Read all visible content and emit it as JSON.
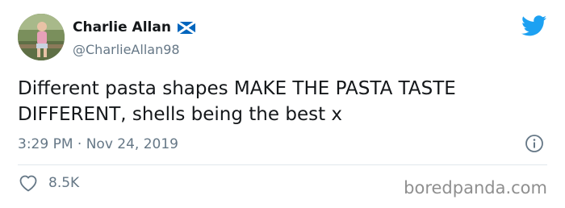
{
  "author": {
    "display_name": "Charlie Allan",
    "handle": "@CharlieAllan98",
    "flag_icon": "scotland-flag-icon",
    "avatar": "profile-photo"
  },
  "brand_icon": "twitter-bird-icon",
  "tweet": {
    "text": "Different pasta shapes MAKE THE PASTA TASTE DIFFERENT, shells being the best x",
    "timestamp": "3:29 PM · Nov 24, 2019"
  },
  "engagement": {
    "likes_icon": "heart-icon",
    "likes": "8.5K",
    "info_icon": "info-icon"
  },
  "watermark": "boredpanda.com",
  "colors": {
    "twitter_blue": "#1da1f2",
    "secondary_text": "#657786",
    "primary_text": "#14171a",
    "divider": "#e1e8ed"
  }
}
